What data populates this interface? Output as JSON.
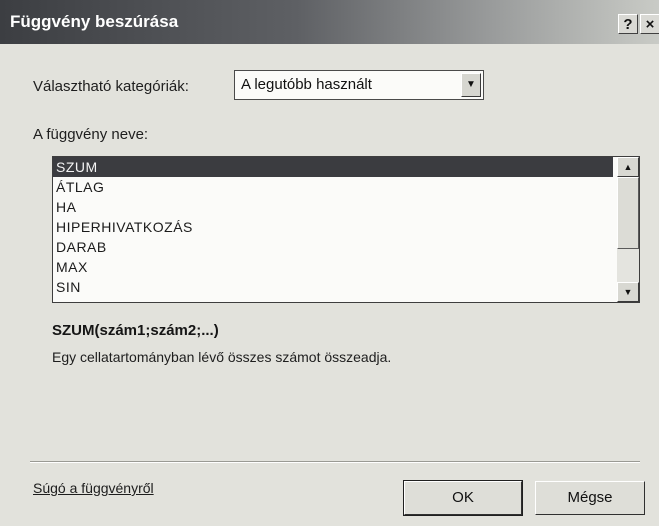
{
  "dialog": {
    "title": "Függvény beszúrása",
    "help_glyph": "?",
    "close_glyph": "×"
  },
  "category": {
    "label": "Választható kategóriák:",
    "selected": "A legutóbb használt"
  },
  "function_list": {
    "label": "A függvény neve:",
    "items": [
      {
        "name": "SZUM",
        "selected": true
      },
      {
        "name": "ÁTLAG",
        "selected": false
      },
      {
        "name": "HA",
        "selected": false
      },
      {
        "name": "HIPERHIVATKOZÁS",
        "selected": false
      },
      {
        "name": "DARAB",
        "selected": false
      },
      {
        "name": "MAX",
        "selected": false
      },
      {
        "name": "SIN",
        "selected": false
      }
    ]
  },
  "details": {
    "signature": "SZUM(szám1;szám2;...)",
    "description": "Egy cellatartományban lévő összes számot összeadja."
  },
  "footer": {
    "help_link": "Súgó a függvényről",
    "ok_label": "OK",
    "cancel_label": "Mégse"
  },
  "colors": {
    "selection": "#3b3c40",
    "dialog_background": "#e2e2dc"
  }
}
